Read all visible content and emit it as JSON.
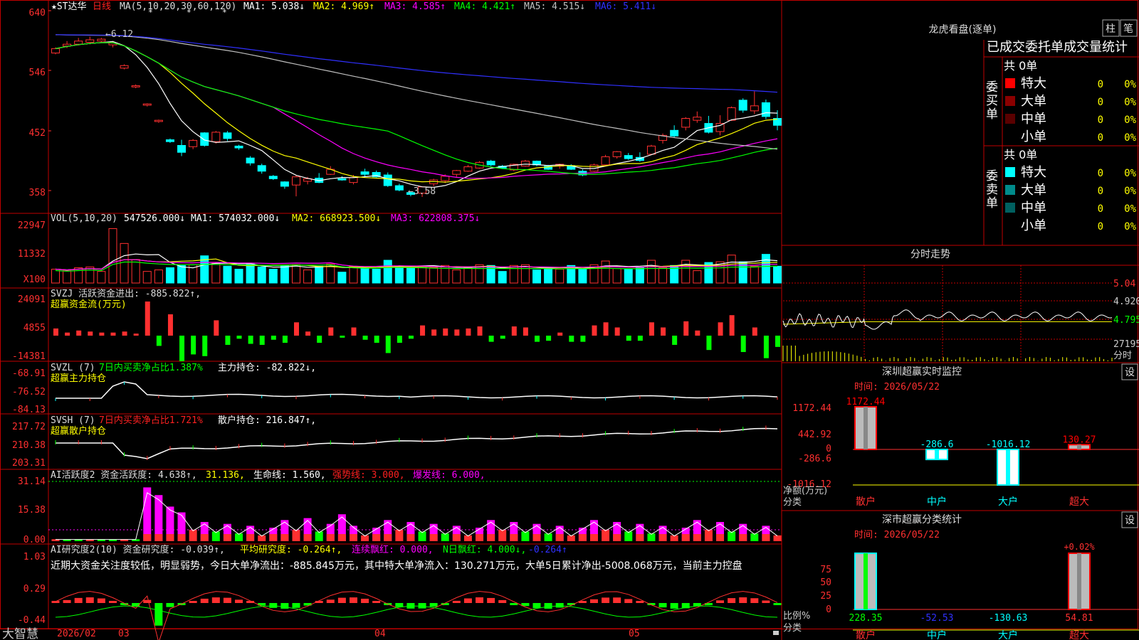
{
  "header": {
    "stock": "★ST达华",
    "period": "日线",
    "ma_label": "MA(5,10,20,30,60,120)",
    "ma": [
      {
        "label": "MA1: 5.038↓",
        "color": "#ffffff"
      },
      {
        "label": "MA2: 4.969↑",
        "color": "#ffff00"
      },
      {
        "label": "MA3: 4.585↑",
        "color": "#ff00ff"
      },
      {
        "label": "MA4: 4.421↑",
        "color": "#00ff00"
      },
      {
        "label": "MA5: 4.515↓",
        "color": "#c0c0c0"
      },
      {
        "label": "MA6: 5.411↓",
        "color": "#3030ff"
      }
    ]
  },
  "price_axis": [
    "640",
    "546",
    "452",
    "358"
  ],
  "price_annotations": {
    "high": "←6.12",
    "low": "←3.58"
  },
  "vol_panel": {
    "title": "VOL(5,10,20)",
    "value": "547526.000↓",
    "ma": [
      {
        "label": "MA1: 574032.000↓",
        "color": "#ffffff"
      },
      {
        "label": "MA2: 668923.500↓",
        "color": "#ffff00"
      },
      {
        "label": "MA3: 622808.375↓",
        "color": "#ff00ff"
      }
    ],
    "axis": [
      "22947",
      "11332",
      "X100"
    ]
  },
  "svzj_panel": {
    "title": "SVZJ  活跃资金进出: -885.822↑,",
    "sub": "超赢资金流(万元)",
    "axis": [
      "24091",
      "4855",
      "-14381"
    ]
  },
  "svzl_panel": {
    "title": "SVZL (7)",
    "t2": "7日内买卖净占比1.387%",
    "t3": "主力持仓: -82.822↓,",
    "sub": "超赢主力持仓",
    "axis": [
      "-68.91",
      "-76.52",
      "-84.13"
    ]
  },
  "svsh_panel": {
    "title": "SVSH (7)",
    "t2": "7日内买卖净占比1.721%",
    "t3": "散户持仓: 216.847↑,",
    "sub": "超赢散户持仓",
    "axis": [
      "217.72",
      "210.38",
      "203.31"
    ]
  },
  "ai_panel": {
    "title": "AI活跃度2 资金活跃度: 4.638↑,",
    "t2": "31.136,",
    "t3": "生命线: 1.560,",
    "t4": "强势线: 3.000,",
    "t5": "爆发线: 6.000,",
    "axis": [
      "31.14",
      "15.38",
      "0.00"
    ]
  },
  "research_panel": {
    "title": "AI研究度2(10) 资金研究度: -0.039↑,",
    "t2": "平均研究度: -0.264↑,",
    "t3": "连续飘红: 0.000,",
    "t4": "N日飘红: 4.000↓,",
    "t5": "-0.264↑",
    "summary": "近期大资金关注度较低，明显弱势，今日大单净流出：-885.845万元，其中特大单净流入：130.271万元，大单5日累计净出-5008.068万元，当前主力控盘",
    "axis": [
      "1.03",
      "0.29",
      "-0.44"
    ]
  },
  "bottom_bar": {
    "logo": "大智慧",
    "dates": [
      "2026/02",
      "03",
      "04",
      "05"
    ]
  },
  "longhu": {
    "title": "龙虎看盘(逐单)",
    "btn1": "柱",
    "btn2": "笔",
    "subtitle": "已成交委托单成交量统计",
    "buy_label": "委买单",
    "sell_label": "委卖单",
    "buy_total": "共 0单",
    "sell_total": "共 0单",
    "buy_rows": [
      {
        "label": "特大",
        "v": "0",
        "p": "0%",
        "color": "#ff0000"
      },
      {
        "label": "大单",
        "v": "0",
        "p": "0%",
        "color": "#8b0000"
      },
      {
        "label": "中单",
        "v": "0",
        "p": "0%",
        "color": "#5a0000"
      },
      {
        "label": "小单",
        "v": "0",
        "p": "0%",
        "color": ""
      }
    ],
    "sell_rows": [
      {
        "label": "特大",
        "v": "0",
        "p": "0%",
        "color": "#00ffff"
      },
      {
        "label": "大单",
        "v": "0",
        "p": "0%",
        "color": "#008b8b"
      },
      {
        "label": "中单",
        "v": "0",
        "p": "0%",
        "color": "#006060"
      },
      {
        "label": "小单",
        "v": "0",
        "p": "0%",
        "color": ""
      }
    ]
  },
  "fenshi": {
    "title": "分时走势",
    "axis": [
      "5.04",
      "4.920",
      "4.795",
      "27195"
    ],
    "axis_label": "分时"
  },
  "monitor": {
    "title": "深圳超赢实时监控",
    "btn": "设",
    "time": "时间: 2026/05/22",
    "axis": [
      "1172.44",
      "442.92",
      "0",
      "-286.6",
      "-1016.12"
    ],
    "ylabel1": "净额(万元)",
    "ylabel2": "分类",
    "bars": [
      {
        "cat": "散户",
        "value": 1172.44,
        "label": "1172.44",
        "color": "#ff0000"
      },
      {
        "cat": "中户",
        "value": -286.6,
        "label": "-286.6",
        "color": "#00ffff"
      },
      {
        "cat": "大户",
        "value": -1016.12,
        "label": "-1016.12",
        "color": "#00ffff"
      },
      {
        "cat": "超大",
        "value": 130.27,
        "label": "130.27",
        "color": "#ff0000"
      }
    ]
  },
  "stats": {
    "title": "深市超赢分类统计",
    "btn": "设",
    "time": "时间: 2026/05/22",
    "axis": [
      "75",
      "50",
      "25",
      "0"
    ],
    "ylabel1": "比例%",
    "ylabel2": "分类",
    "bars": [
      {
        "cat": "散户",
        "value": 228.35,
        "label": "228.35",
        "pct": 100,
        "color": "#00ffff"
      },
      {
        "cat": "中户",
        "value": -52.53,
        "label": "-52.53",
        "pct": 0,
        "color": "#0000ff"
      },
      {
        "cat": "大户",
        "value": -130.63,
        "label": "-130.63",
        "pct": 0,
        "color": "#00ffff"
      },
      {
        "cat": "超大",
        "value": 54.81,
        "label": "54.81",
        "pct": 100,
        "color": "#ff0000",
        "top": "+0.02%"
      }
    ]
  },
  "chart_data": {
    "type": "candlestick",
    "title": "★ST达华 日线",
    "ylim": [
      3.4,
      6.5
    ],
    "x": [
      "2026/02",
      "03",
      "04",
      "05"
    ],
    "candles": [
      [
        5.86,
        5.93,
        5.84,
        5.95
      ],
      [
        5.97,
        6.0,
        5.94,
        6.05
      ],
      [
        6.0,
        6.05,
        5.98,
        6.1
      ],
      [
        6.03,
        6.07,
        6.0,
        6.12
      ],
      [
        6.05,
        6.08,
        6.02,
        6.1
      ],
      [
        5.99,
        6.02,
        5.95,
        6.05
      ],
      [
        5.62,
        5.66,
        5.6,
        5.68
      ],
      [
        5.32,
        5.34,
        5.3,
        5.36
      ],
      [
        5.03,
        5.05,
        5.01,
        5.06
      ],
      [
        4.77,
        4.79,
        4.75,
        4.8
      ],
      [
        4.48,
        4.45,
        4.43,
        4.5
      ],
      [
        4.39,
        4.28,
        4.22,
        4.48
      ],
      [
        4.37,
        4.47,
        4.33,
        4.49
      ],
      [
        4.59,
        4.39,
        4.37,
        4.6
      ],
      [
        4.45,
        4.6,
        4.42,
        4.62
      ],
      [
        4.59,
        4.5,
        4.46,
        4.62
      ],
      [
        4.38,
        4.35,
        4.32,
        4.4
      ],
      [
        4.19,
        4.11,
        4.07,
        4.22
      ],
      [
        4.07,
        3.98,
        3.94,
        4.1
      ],
      [
        3.9,
        3.86,
        3.84,
        3.92
      ],
      [
        3.81,
        3.74,
        3.7,
        3.82
      ],
      [
        3.76,
        3.89,
        3.58,
        3.91
      ],
      [
        3.82,
        3.86,
        3.77,
        3.89
      ],
      [
        3.87,
        3.8,
        3.79,
        3.95
      ],
      [
        3.93,
        4.01,
        3.92,
        4.06
      ],
      [
        3.86,
        3.84,
        3.83,
        3.9
      ],
      [
        3.8,
        3.88,
        3.77,
        3.92
      ],
      [
        3.97,
        3.93,
        3.88,
        4.02
      ],
      [
        3.96,
        3.89,
        3.88,
        3.99
      ],
      [
        3.92,
        3.75,
        3.73,
        3.96
      ],
      [
        3.75,
        3.68,
        3.66,
        3.78
      ],
      [
        3.64,
        3.61,
        3.58,
        3.66
      ],
      [
        3.63,
        3.73,
        3.57,
        3.74
      ],
      [
        3.78,
        3.84,
        3.74,
        3.86
      ],
      [
        3.83,
        3.9,
        3.79,
        3.93
      ],
      [
        3.93,
        3.99,
        3.89,
        4.0
      ],
      [
        3.98,
        4.05,
        3.97,
        4.08
      ],
      [
        4.03,
        4.12,
        4.02,
        4.14
      ],
      [
        4.14,
        4.08,
        4.06,
        4.16
      ],
      [
        4.06,
        4.03,
        4.02,
        4.08
      ],
      [
        4.0,
        4.09,
        3.98,
        4.1
      ],
      [
        4.06,
        4.14,
        4.05,
        4.16
      ],
      [
        4.14,
        4.08,
        4.06,
        4.15
      ],
      [
        4.06,
        4.01,
        4.0,
        4.08
      ],
      [
        4.06,
        4.09,
        4.02,
        4.1
      ],
      [
        4.07,
        4.01,
        4.0,
        4.09
      ],
      [
        3.98,
        3.92,
        3.9,
        4.01
      ],
      [
        3.98,
        4.08,
        3.97,
        4.1
      ],
      [
        4.08,
        4.21,
        4.07,
        4.24
      ],
      [
        4.21,
        4.29,
        4.18,
        4.3
      ],
      [
        4.23,
        4.18,
        4.16,
        4.27
      ],
      [
        4.2,
        4.15,
        4.13,
        4.28
      ],
      [
        4.25,
        4.38,
        4.24,
        4.4
      ],
      [
        4.47,
        4.55,
        4.42,
        4.58
      ],
      [
        4.63,
        4.54,
        4.52,
        4.71
      ],
      [
        4.68,
        4.82,
        4.63,
        4.84
      ],
      [
        4.79,
        4.84,
        4.75,
        4.93
      ],
      [
        4.74,
        4.6,
        4.58,
        4.86
      ],
      [
        4.61,
        4.74,
        4.55,
        4.87
      ],
      [
        4.79,
        4.99,
        4.78,
        5.01
      ],
      [
        5.11,
        4.95,
        4.91,
        5.14
      ],
      [
        4.94,
        5.02,
        4.89,
        5.25
      ],
      [
        5.07,
        4.85,
        4.81,
        5.12
      ],
      [
        4.82,
        4.71,
        4.63,
        4.95
      ]
    ]
  }
}
